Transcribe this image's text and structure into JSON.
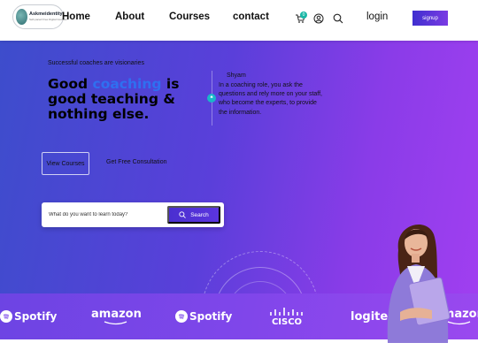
{
  "nav": {
    "logo_name": "Askmeidentity",
    "logo_tagline": "Self-paced Free Digital Courses",
    "links": [
      "Home",
      "About",
      "Courses",
      "contact"
    ],
    "cart_count": "0",
    "login": "login",
    "signup": "signup",
    "icons": [
      "cart-icon",
      "user-icon",
      "search-icon"
    ]
  },
  "hero": {
    "eyebrow": "Successful coaches are visionaries",
    "headline_prefix": "Good ",
    "headline_highlight": "coaching",
    "headline_suffix": " is good teaching & nothing else.",
    "quote_mark": "❝",
    "quote_author": "Shyam",
    "quote_text": "In a coaching role, you ask the questions and rely more on your staff, who become the experts, to provide the information.",
    "btn_courses": "View Courses",
    "btn_consult": "Get Free Consultation",
    "search_placeholder": "What do you want to learn today?",
    "search_button": "Search"
  },
  "brands": [
    "Spotify",
    "amazon",
    "Spotify",
    "CISCO",
    "logitech",
    "amazon"
  ],
  "colors": {
    "accent": "#4a2fd0",
    "highlight": "#2f6ff0",
    "badge": "#19b7a6"
  }
}
